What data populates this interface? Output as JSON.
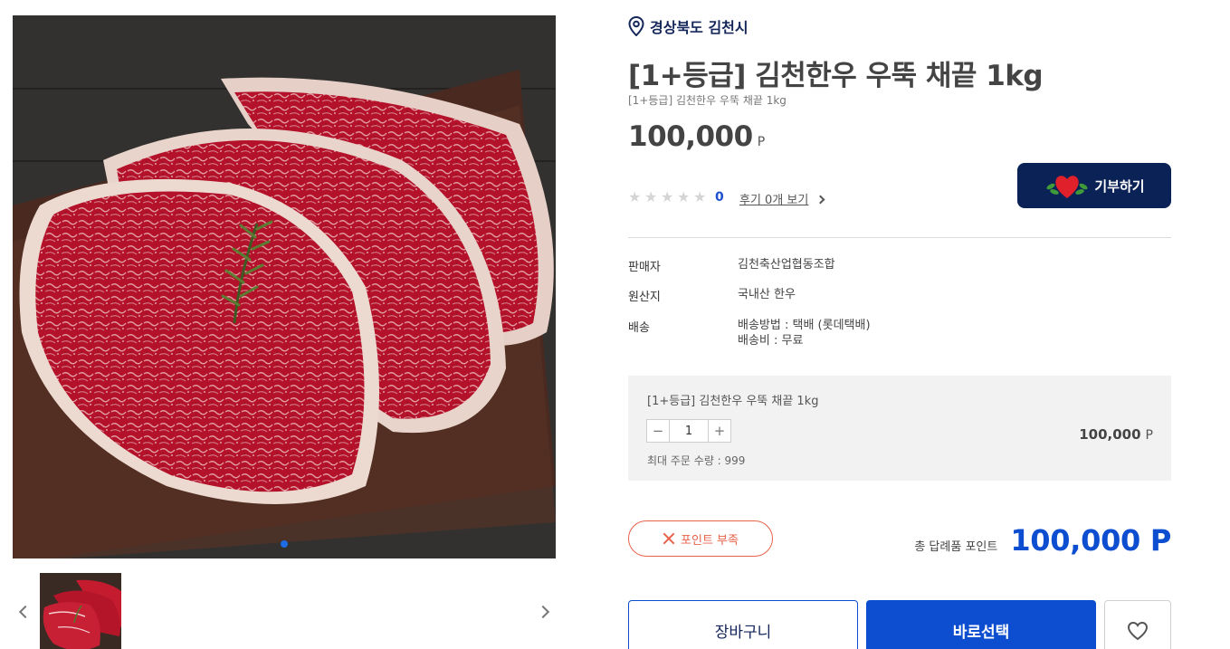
{
  "product": {
    "region": "경상북도 김천시",
    "title": "[1+등급] 김천한우 우뚝 채끝 1kg",
    "subtitle": "[1+등급] 김천한우 우뚝 채끝 1kg",
    "price": "100,000",
    "price_unit": "P",
    "rating": {
      "stars_filled": 0,
      "stars_total": 5,
      "count": "0"
    },
    "review_link": "후기 0개 보기",
    "donate_button": "기부하기"
  },
  "specs": [
    {
      "label": "판매자",
      "value": "김천축산업협동조합"
    },
    {
      "label": "원산지",
      "value": "국내산 한우"
    },
    {
      "label": "배송",
      "value_lines": [
        "배송방법 : 택배 (롯데택배)",
        "배송비 : 무료"
      ]
    }
  ],
  "option": {
    "name": "[1+등급] 김천한우 우뚝 채끝 1kg",
    "minus": "−",
    "plus": "+",
    "quantity": "1",
    "price": "100,000",
    "price_unit": "P",
    "max_quantity": "최대 주문 수량 : 999"
  },
  "status": {
    "insufficient_points": "포인트 부족"
  },
  "total": {
    "label": "총 답례품 포인트",
    "value": "100,000 P"
  },
  "actions": {
    "cart": "장바구니",
    "buy": "바로선택"
  },
  "gallery": {
    "active_index": 0,
    "image_count": 1
  },
  "colors": {
    "primary": "#0d4ed0",
    "navy": "#0b2257",
    "warning": "#e8624a"
  },
  "icons": [
    "location-pin-icon",
    "star-icon",
    "chevron-right-icon",
    "heart-icon",
    "close-icon",
    "chevron-left-icon"
  ]
}
